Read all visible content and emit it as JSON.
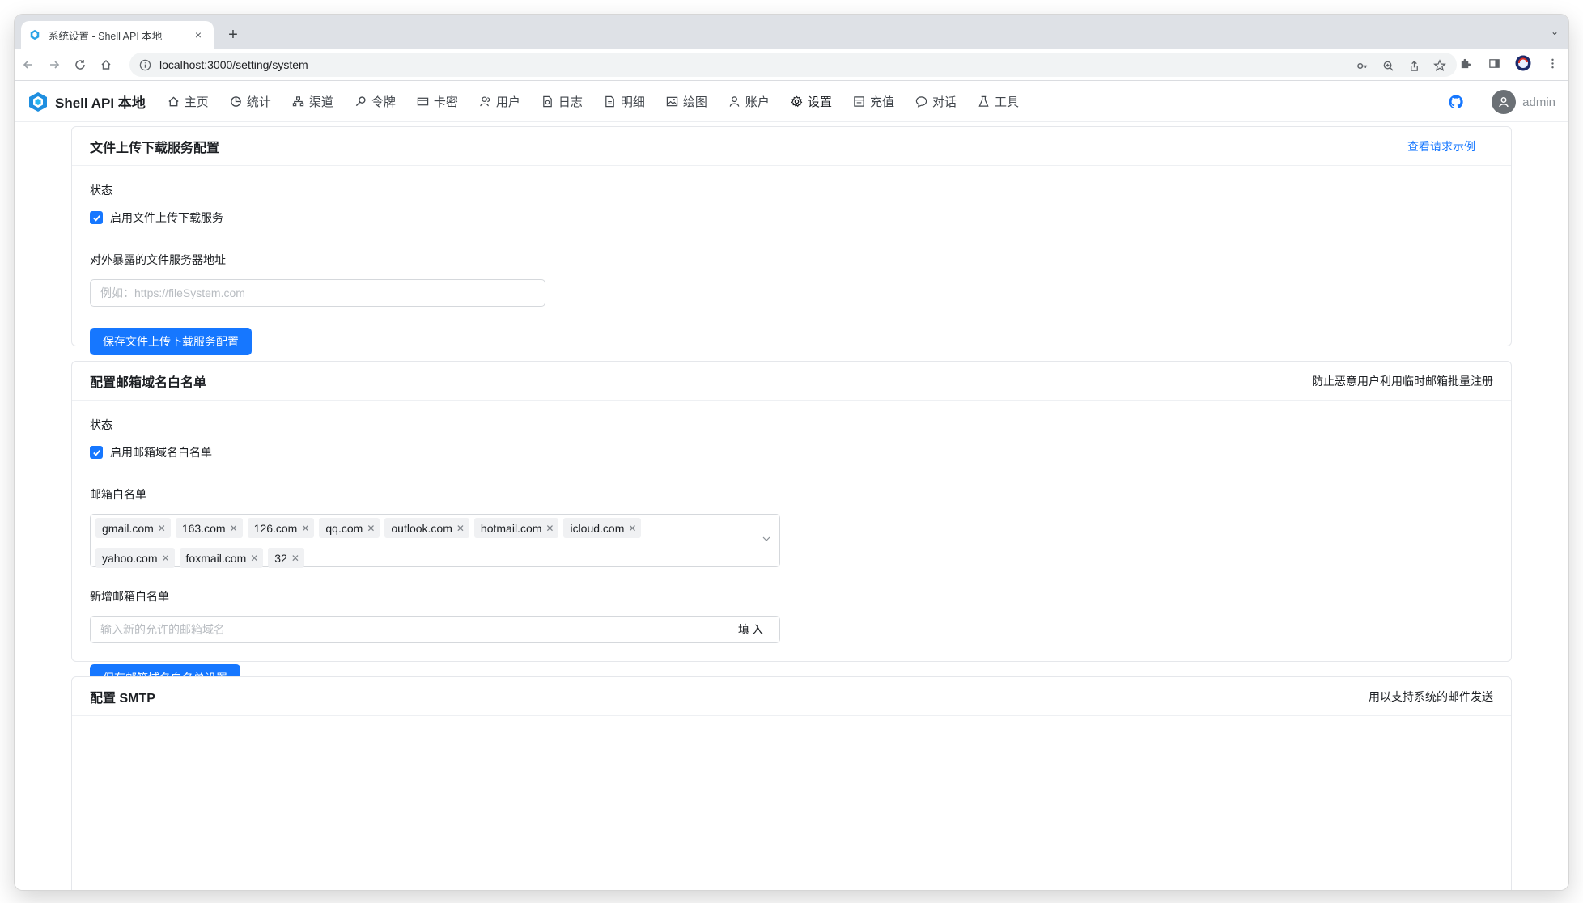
{
  "browser": {
    "tab_title": "系统设置 - Shell API 本地",
    "tab_close": "×",
    "new_tab": "+",
    "tab_menu": "⌄",
    "url": "localhost:3000/setting/system"
  },
  "header": {
    "brand": "Shell API 本地",
    "menu": [
      {
        "label": "主页",
        "icon": "home-icon"
      },
      {
        "label": "统计",
        "icon": "pie-chart-icon"
      },
      {
        "label": "渠道",
        "icon": "sitemap-icon"
      },
      {
        "label": "令牌",
        "icon": "key-icon"
      },
      {
        "label": "卡密",
        "icon": "credit-card-icon"
      },
      {
        "label": "用户",
        "icon": "users-icon"
      },
      {
        "label": "日志",
        "icon": "log-icon"
      },
      {
        "label": "明细",
        "icon": "detail-icon"
      },
      {
        "label": "绘图",
        "icon": "image-icon"
      },
      {
        "label": "账户",
        "icon": "user-icon"
      },
      {
        "label": "设置",
        "icon": "gear-icon"
      },
      {
        "label": "充值",
        "icon": "wallet-icon"
      },
      {
        "label": "对话",
        "icon": "chat-icon"
      },
      {
        "label": "工具",
        "icon": "flask-icon"
      }
    ],
    "username": "admin"
  },
  "file_service": {
    "title": "文件上传下载服务配置",
    "extra_link": "查看请求示例",
    "status_label": "状态",
    "enable_label": "启用文件上传下载服务",
    "address_label": "对外暴露的文件服务器地址",
    "address_placeholder": "例如：https://fileSystem.com",
    "save_label": "保存文件上传下载服务配置"
  },
  "email_whitelist": {
    "title": "配置邮箱域名白名单",
    "extra": "防止恶意用户利用临时邮箱批量注册",
    "status_label": "状态",
    "enable_label": "启用邮箱域名白名单",
    "list_label": "邮箱白名单",
    "domains": [
      "gmail.com",
      "163.com",
      "126.com",
      "qq.com",
      "outlook.com",
      "hotmail.com",
      "icloud.com",
      "yahoo.com",
      "foxmail.com",
      "32"
    ],
    "add_label": "新增邮箱白名单",
    "add_placeholder": "输入新的允许的邮箱域名",
    "fill_button": "填入",
    "save_label": "保存邮箱域名白名单设置"
  },
  "smtp": {
    "title": "配置 SMTP",
    "extra": "用以支持系统的邮件发送"
  },
  "colors": {
    "primary": "#1677ff",
    "text": "#1c1f23"
  }
}
